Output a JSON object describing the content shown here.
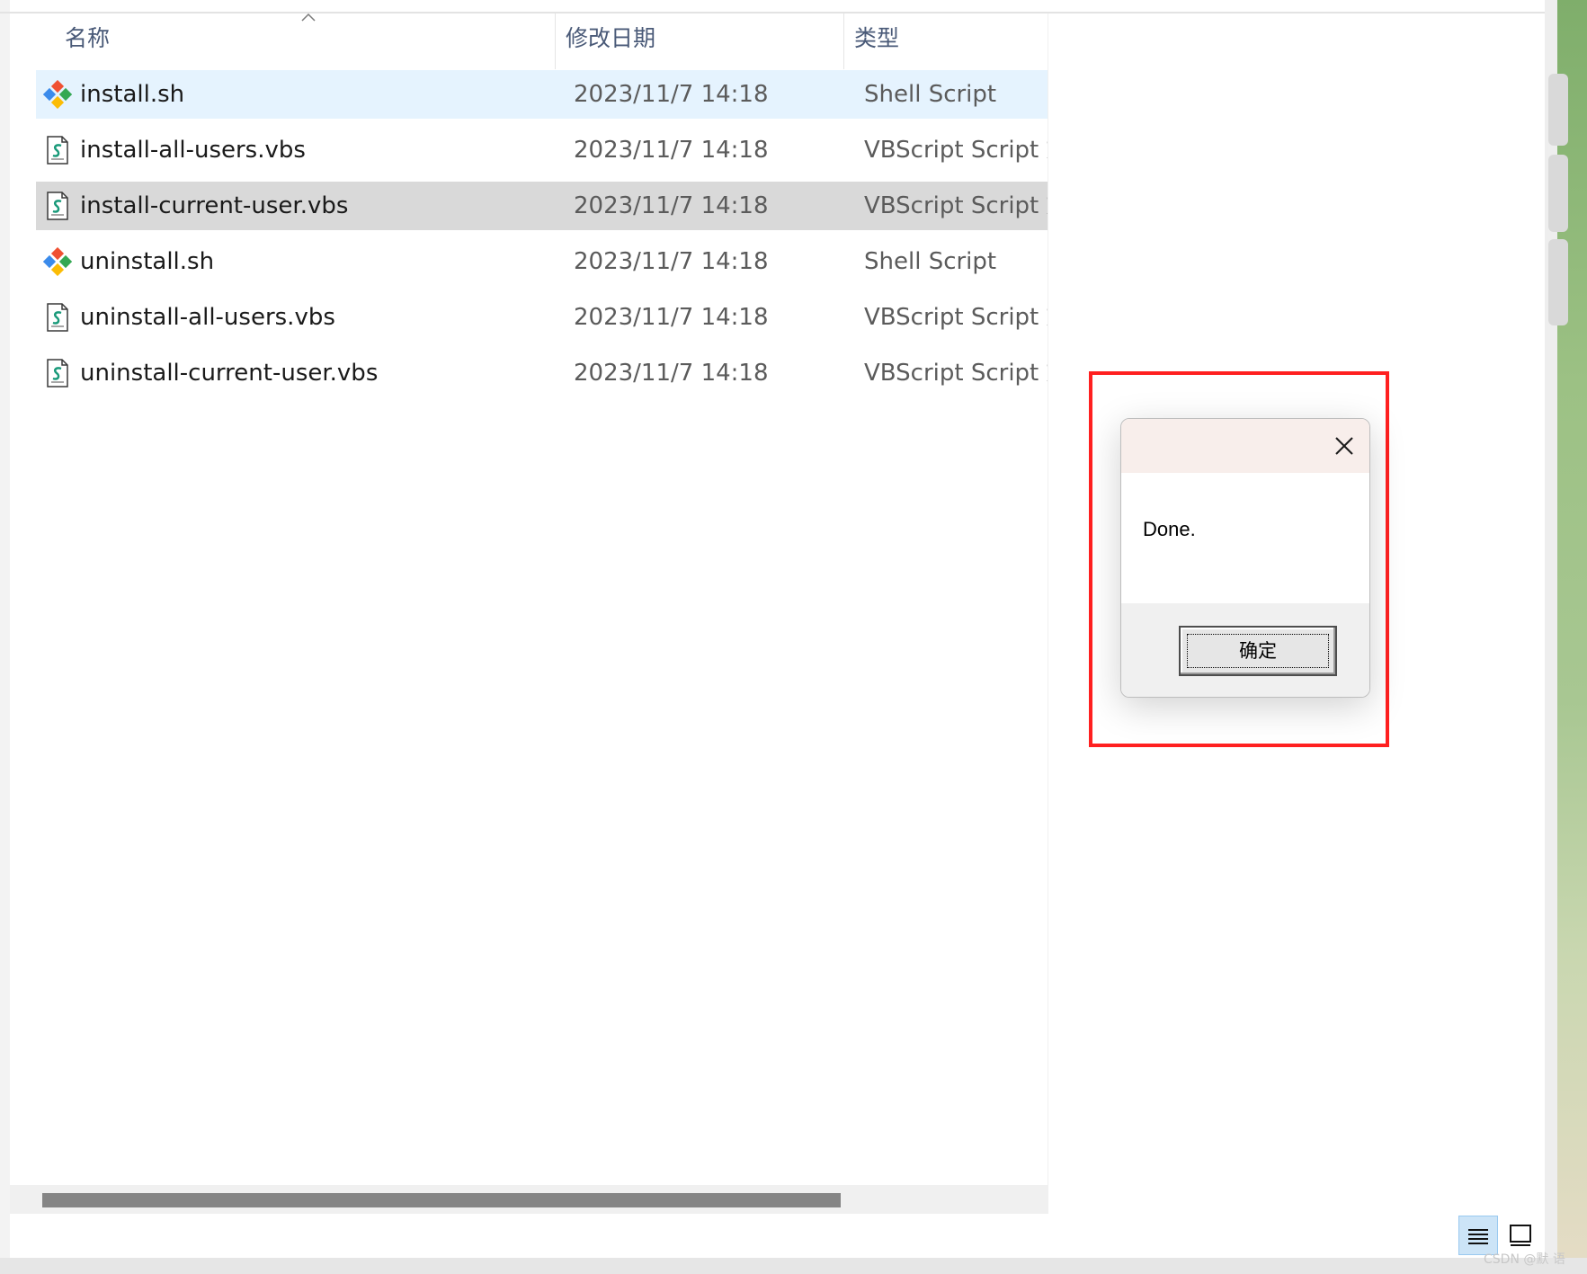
{
  "columns": {
    "name": "名称",
    "modified": "修改日期",
    "type": "类型"
  },
  "files": [
    {
      "name": "install.sh",
      "modified": "2023/11/7 14:18",
      "type": "Shell Script",
      "icon": "git-shell-icon",
      "state": "hover"
    },
    {
      "name": "install-all-users.vbs",
      "modified": "2023/11/7 14:18",
      "type": "VBScript Script 文件",
      "icon": "vbscript-file-icon",
      "state": "normal"
    },
    {
      "name": "install-current-user.vbs",
      "modified": "2023/11/7 14:18",
      "type": "VBScript Script 文件",
      "icon": "vbscript-file-icon",
      "state": "selected"
    },
    {
      "name": "uninstall.sh",
      "modified": "2023/11/7 14:18",
      "type": "Shell Script",
      "icon": "git-shell-icon",
      "state": "normal"
    },
    {
      "name": "uninstall-all-users.vbs",
      "modified": "2023/11/7 14:18",
      "type": "VBScript Script 文件",
      "icon": "vbscript-file-icon",
      "state": "normal"
    },
    {
      "name": "uninstall-current-user.vbs",
      "modified": "2023/11/7 14:18",
      "type": "VBScript Script 文件",
      "icon": "vbscript-file-icon",
      "state": "normal"
    }
  ],
  "dialog": {
    "message": "Done.",
    "ok_label": "确定",
    "close_icon": "close-icon"
  },
  "watermark": "CSDN @默 语",
  "colors": {
    "highlight_border": "#ff2020",
    "hover_row": "#e5f3fe",
    "selected_row": "#d9d9d9",
    "dialog_titlebar": "#f8eeeb"
  }
}
